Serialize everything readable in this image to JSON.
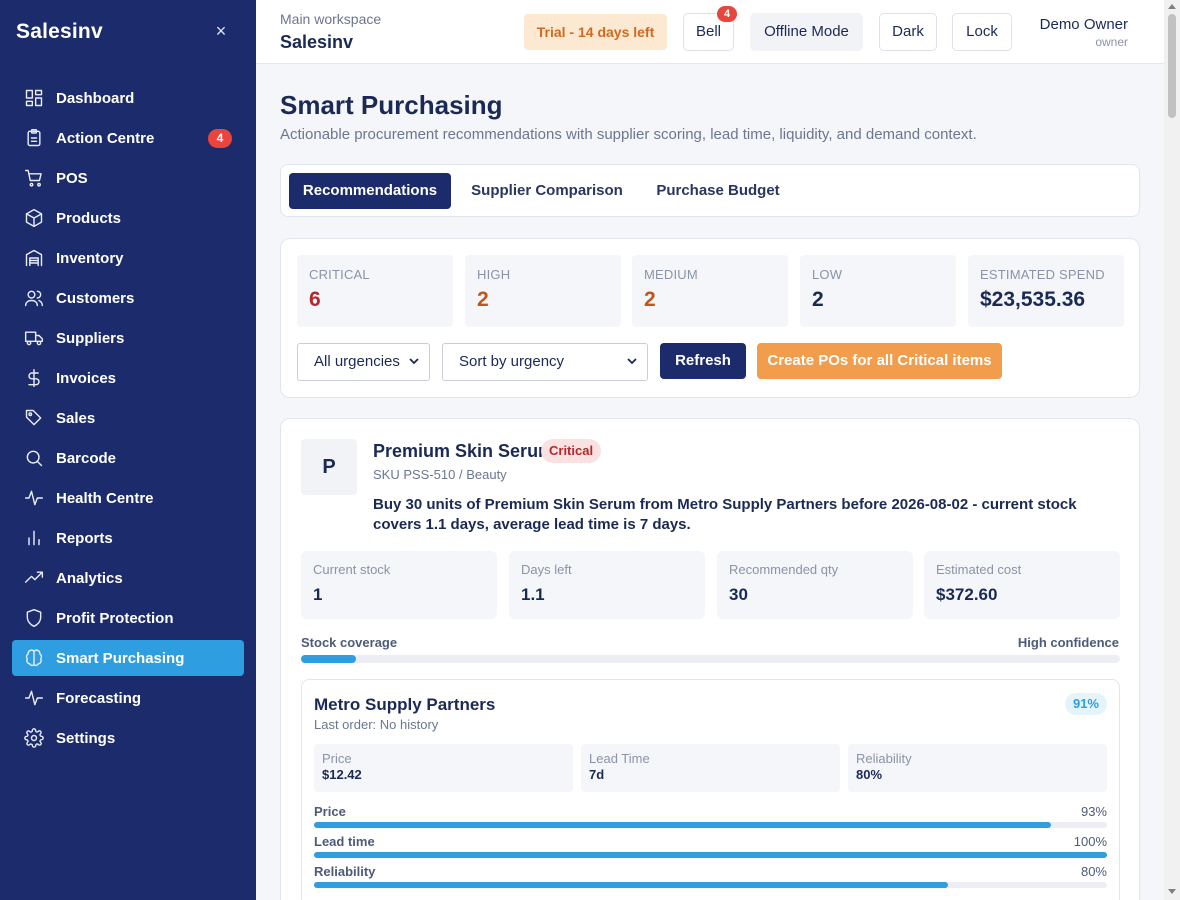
{
  "sidebar": {
    "brand": "Salesinv",
    "close_label": "×",
    "items": [
      {
        "label": "Dashboard",
        "icon": "dashboard-icon"
      },
      {
        "label": "Action Centre",
        "icon": "clipboard-icon",
        "badge": "4"
      },
      {
        "label": "POS",
        "icon": "cart-icon"
      },
      {
        "label": "Products",
        "icon": "box-icon"
      },
      {
        "label": "Inventory",
        "icon": "warehouse-icon"
      },
      {
        "label": "Customers",
        "icon": "users-icon"
      },
      {
        "label": "Suppliers",
        "icon": "truck-icon"
      },
      {
        "label": "Invoices",
        "icon": "dollar-icon"
      },
      {
        "label": "Sales",
        "icon": "tag-icon"
      },
      {
        "label": "Barcode",
        "icon": "search-icon"
      },
      {
        "label": "Health Centre",
        "icon": "pulse-icon"
      },
      {
        "label": "Reports",
        "icon": "bar-chart-icon"
      },
      {
        "label": "Analytics",
        "icon": "trend-up-icon"
      },
      {
        "label": "Profit Protection",
        "icon": "shield-icon"
      },
      {
        "label": "Smart Purchasing",
        "icon": "brain-icon",
        "active": true
      },
      {
        "label": "Forecasting",
        "icon": "pulse-icon"
      },
      {
        "label": "Settings",
        "icon": "gear-icon"
      }
    ]
  },
  "topbar": {
    "workspace_label": "Main workspace",
    "workspace_name": "Salesinv",
    "trial": "Trial - 14 days left",
    "bell": "Bell",
    "bell_badge": "4",
    "offline": "Offline Mode",
    "dark": "Dark",
    "lock": "Lock",
    "user_name": "Demo Owner",
    "user_role": "owner"
  },
  "page": {
    "title": "Smart Purchasing",
    "subtitle": "Actionable procurement recommendations with supplier scoring, lead time, liquidity, and demand context."
  },
  "tabs": [
    {
      "label": "Recommendations",
      "active": true
    },
    {
      "label": "Supplier Comparison"
    },
    {
      "label": "Purchase Budget"
    }
  ],
  "summary": {
    "stats": [
      {
        "label": "CRITICAL",
        "value": "6",
        "color": "#b4282c"
      },
      {
        "label": "HIGH",
        "value": "2",
        "color": "#c0561b"
      },
      {
        "label": "MEDIUM",
        "value": "2",
        "color": "#c0561b"
      },
      {
        "label": "LOW",
        "value": "2",
        "color": "#1b2a55"
      },
      {
        "label": "ESTIMATED SPEND",
        "value": "$23,535.36",
        "color": "#1b2a55"
      }
    ],
    "urgency_filter": "All urgencies",
    "sort": "Sort by urgency",
    "refresh": "Refresh",
    "create_pos": "Create POs for all Critical items"
  },
  "recommendation": {
    "initial": "P",
    "name": "Premium Skin Serum",
    "badge": "Critical",
    "sku": "SKU PSS-510 / Beauty",
    "text": "Buy 30 units of Premium Skin Serum from Metro Supply Partners before 2026-08-02 - current stock covers 1.1 days, average lead time is 7 days.",
    "metrics": [
      {
        "label": "Current stock",
        "value": "1"
      },
      {
        "label": "Days left",
        "value": "1.1"
      },
      {
        "label": "Recommended qty",
        "value": "30"
      },
      {
        "label": "Estimated cost",
        "value": "$372.60"
      }
    ],
    "coverage_label": "Stock coverage",
    "confidence": "High confidence",
    "coverage_fraction": 0.067,
    "supplier": {
      "name": "Metro Supply Partners",
      "last_order": "Last order: No history",
      "score": "91%",
      "boxes": [
        {
          "label": "Price",
          "value": "$12.42"
        },
        {
          "label": "Lead Time",
          "value": "7d"
        },
        {
          "label": "Reliability",
          "value": "80%"
        }
      ],
      "bars": [
        {
          "label": "Price",
          "percent": "93%",
          "fraction": 0.93
        },
        {
          "label": "Lead time",
          "percent": "100%",
          "fraction": 1.0
        },
        {
          "label": "Reliability",
          "percent": "80%",
          "fraction": 0.8
        }
      ]
    }
  }
}
